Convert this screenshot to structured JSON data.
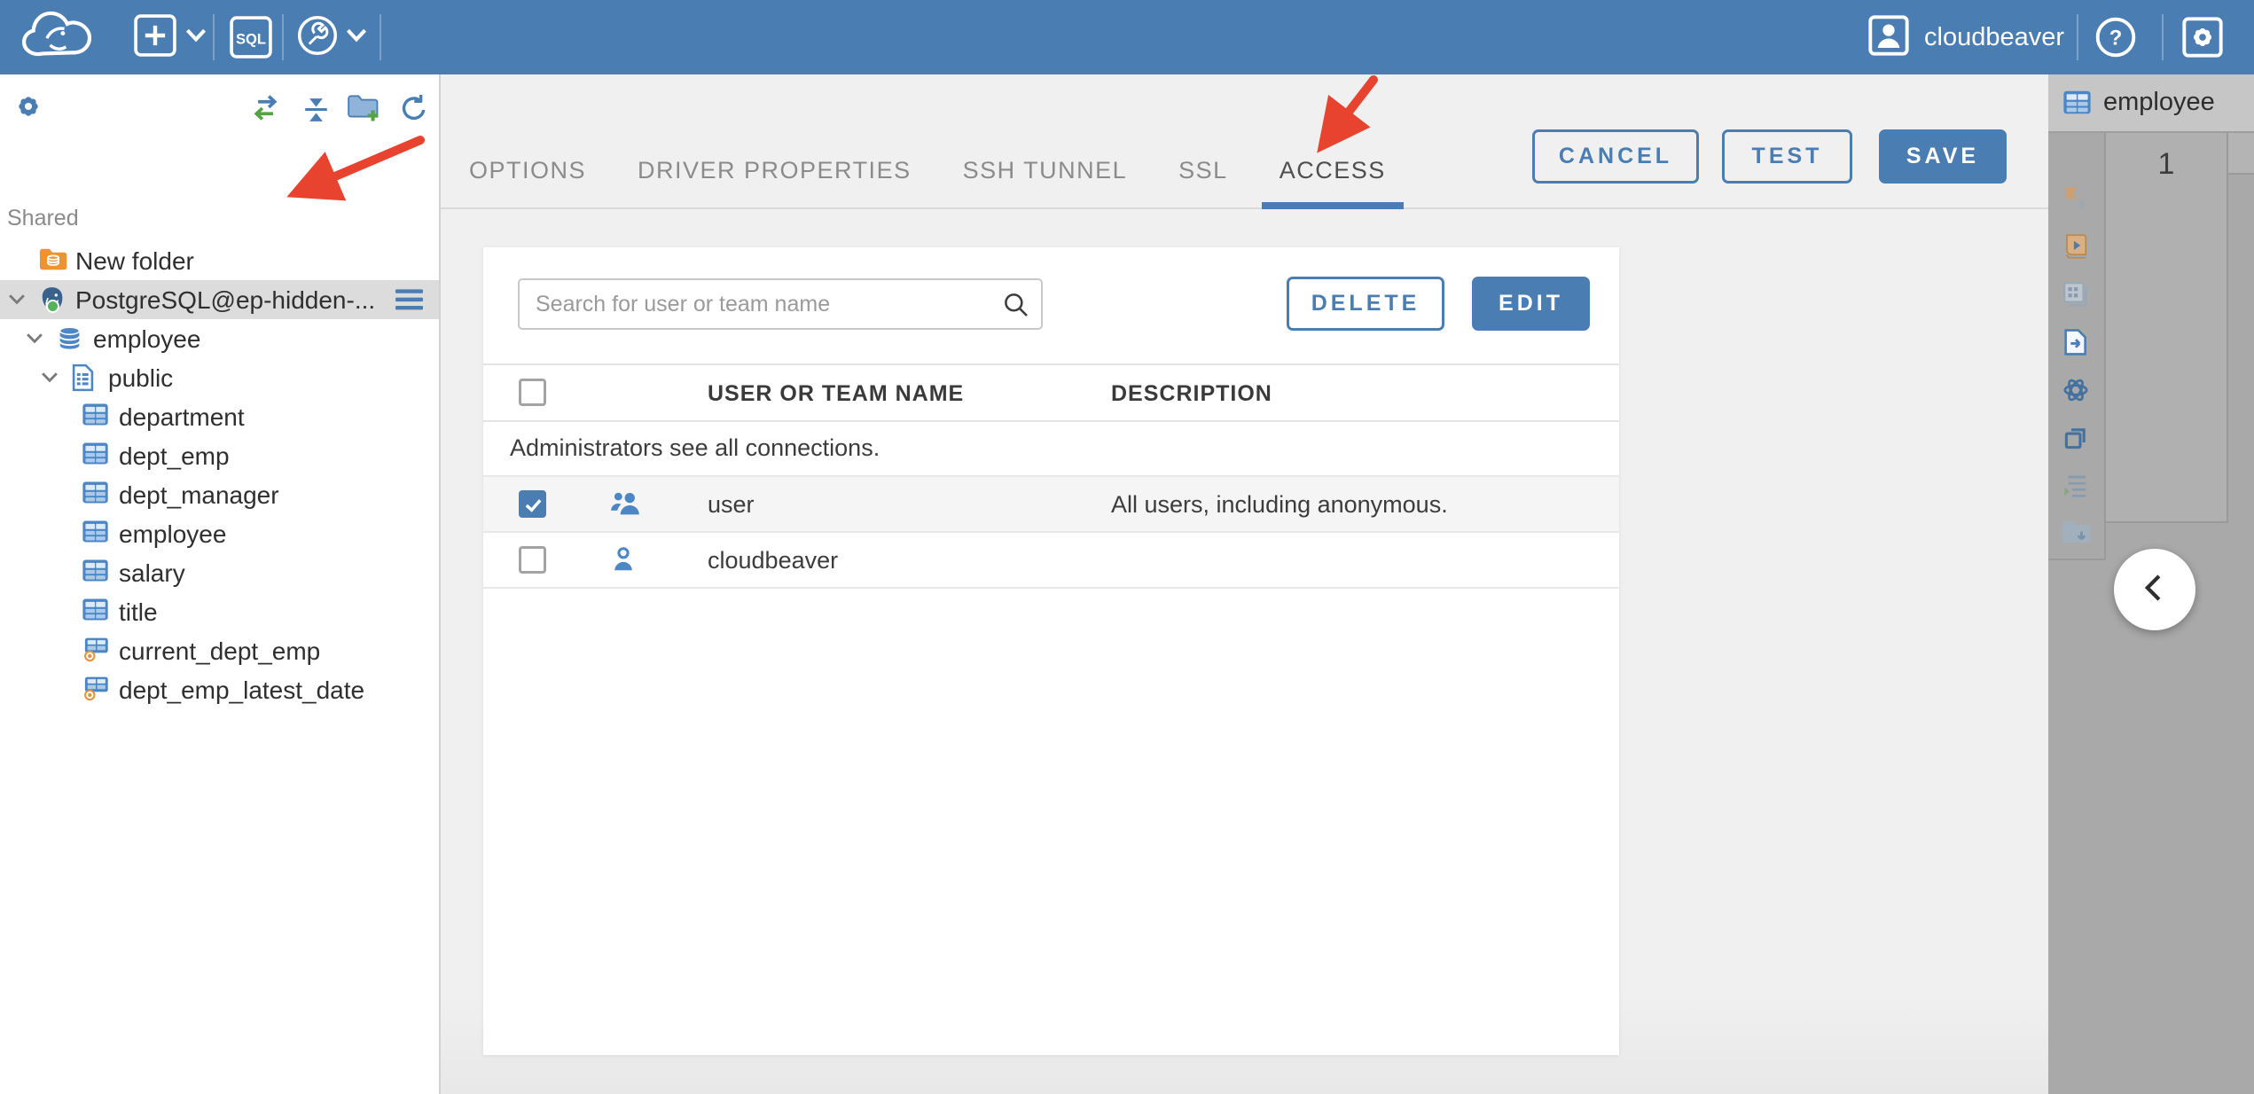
{
  "topbar": {
    "user": "cloudbeaver",
    "sql_badge": "SQL"
  },
  "sidebar": {
    "section_label": "Shared",
    "tree": [
      {
        "label": "New folder",
        "icon": "folder-db",
        "depth": 0
      },
      {
        "label": "PostgreSQL@ep-hidden-...",
        "icon": "postgres",
        "depth": 0,
        "chevron": "down",
        "selected": true,
        "menu": true,
        "status": "connected"
      },
      {
        "label": "employee",
        "icon": "database",
        "depth": 1,
        "chevron": "down"
      },
      {
        "label": "public",
        "icon": "schema",
        "depth": 2,
        "chevron": "down"
      },
      {
        "label": "department",
        "icon": "table",
        "depth": 3
      },
      {
        "label": "dept_emp",
        "icon": "table",
        "depth": 3
      },
      {
        "label": "dept_manager",
        "icon": "table",
        "depth": 3
      },
      {
        "label": "employee",
        "icon": "table",
        "depth": 3
      },
      {
        "label": "salary",
        "icon": "table",
        "depth": 3
      },
      {
        "label": "title",
        "icon": "table",
        "depth": 3
      },
      {
        "label": "current_dept_emp",
        "icon": "view",
        "depth": 3
      },
      {
        "label": "dept_emp_latest_date",
        "icon": "view",
        "depth": 3
      }
    ]
  },
  "main": {
    "tabs": [
      {
        "label": "OPTIONS",
        "active": false
      },
      {
        "label": "DRIVER PROPERTIES",
        "active": false
      },
      {
        "label": "SSH TUNNEL",
        "active": false
      },
      {
        "label": "SSL",
        "active": false
      },
      {
        "label": "ACCESS",
        "active": true
      }
    ],
    "buttons": {
      "cancel": "CANCEL",
      "test": "TEST",
      "save": "SAVE"
    },
    "access": {
      "search_placeholder": "Search for user or team name",
      "delete_label": "DELETE",
      "edit_label": "EDIT",
      "columns": [
        "USER OR TEAM NAME",
        "DESCRIPTION"
      ],
      "note": "Administrators see all connections.",
      "rows": [
        {
          "name": "user",
          "description": "All users, including anonymous.",
          "icon": "team-icon",
          "checked": true,
          "highlighted": true
        },
        {
          "name": "cloudbeaver",
          "description": "",
          "icon": "user-icon",
          "checked": false,
          "highlighted": false
        }
      ]
    }
  },
  "right_panel": {
    "tab_label": "employee",
    "row_number": "1",
    "toolbar_icons": [
      "bookmark-add",
      "script-run",
      "grid-form",
      "export-data",
      "ai-assistant",
      "duplicate",
      "log-list",
      "import-folder"
    ]
  },
  "colors": {
    "topbar_blue": "#4a7db2",
    "accent_blue": "#4a7db2",
    "arrow_red": "#e8432e",
    "status_green": "#52b35c",
    "tree_selection": "#dcdcdc",
    "panel_gray": "#a9a9a9"
  }
}
